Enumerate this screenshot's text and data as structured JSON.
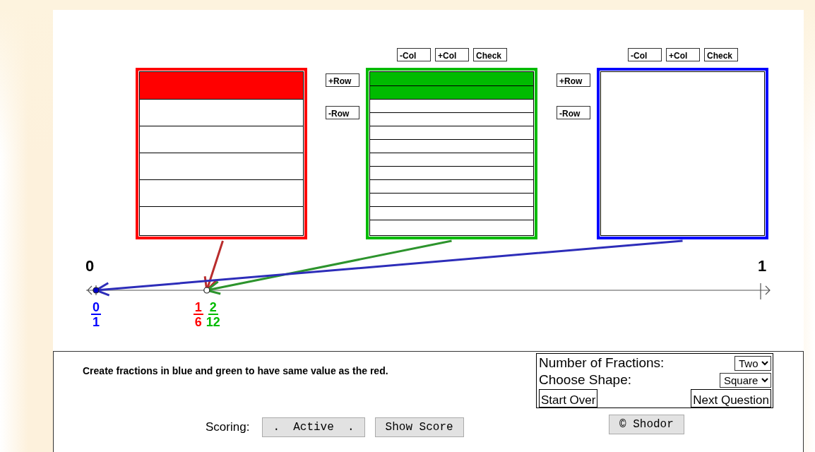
{
  "fractions": [
    {
      "color": "#ff0000",
      "rows": [
        {
          "shaded": true
        },
        {
          "shaded": false
        },
        {
          "shaded": false
        },
        {
          "shaded": false
        },
        {
          "shaded": false
        },
        {
          "shaded": false
        }
      ]
    },
    {
      "color": "#00bb00",
      "buttons_top": [
        "-Col",
        "+Col",
        "Check"
      ],
      "buttons_side": [
        "+Row",
        "-Row"
      ],
      "rows": [
        {
          "shaded": true
        },
        {
          "shaded": true
        },
        {
          "shaded": false
        },
        {
          "shaded": false
        },
        {
          "shaded": false
        },
        {
          "shaded": false
        },
        {
          "shaded": false
        },
        {
          "shaded": false
        },
        {
          "shaded": false
        },
        {
          "shaded": false
        },
        {
          "shaded": false
        },
        {
          "shaded": false
        }
      ]
    },
    {
      "color": "#0000ff",
      "buttons_top": [
        "-Col",
        "+Col",
        "Check"
      ],
      "buttons_side": [
        "+Row",
        "-Row"
      ],
      "rows": [
        {
          "shaded": false
        }
      ]
    }
  ],
  "number_line": {
    "start_label": "0",
    "end_label": "1"
  },
  "markers": [
    {
      "color": "#0000ff",
      "numerator": "0",
      "denominator": "1"
    },
    {
      "color": "#ff0000",
      "numerator": "1",
      "denominator": "6"
    },
    {
      "color": "#00bb00",
      "numerator": "2",
      "denominator": "12"
    }
  ],
  "instructions": "Create fractions in blue and green to have same value as the red.",
  "settings": [
    {
      "label": "Number of Fractions:",
      "value": "Two"
    },
    {
      "label": "Choose Shape:",
      "value": "Square"
    }
  ],
  "panel_buttons": [
    "Start Over",
    "Next Question"
  ],
  "scoring": {
    "label": "Scoring:",
    "buttons": [
      ".  Active  .",
      "Show Score"
    ]
  },
  "credit_button": "© Shodor"
}
